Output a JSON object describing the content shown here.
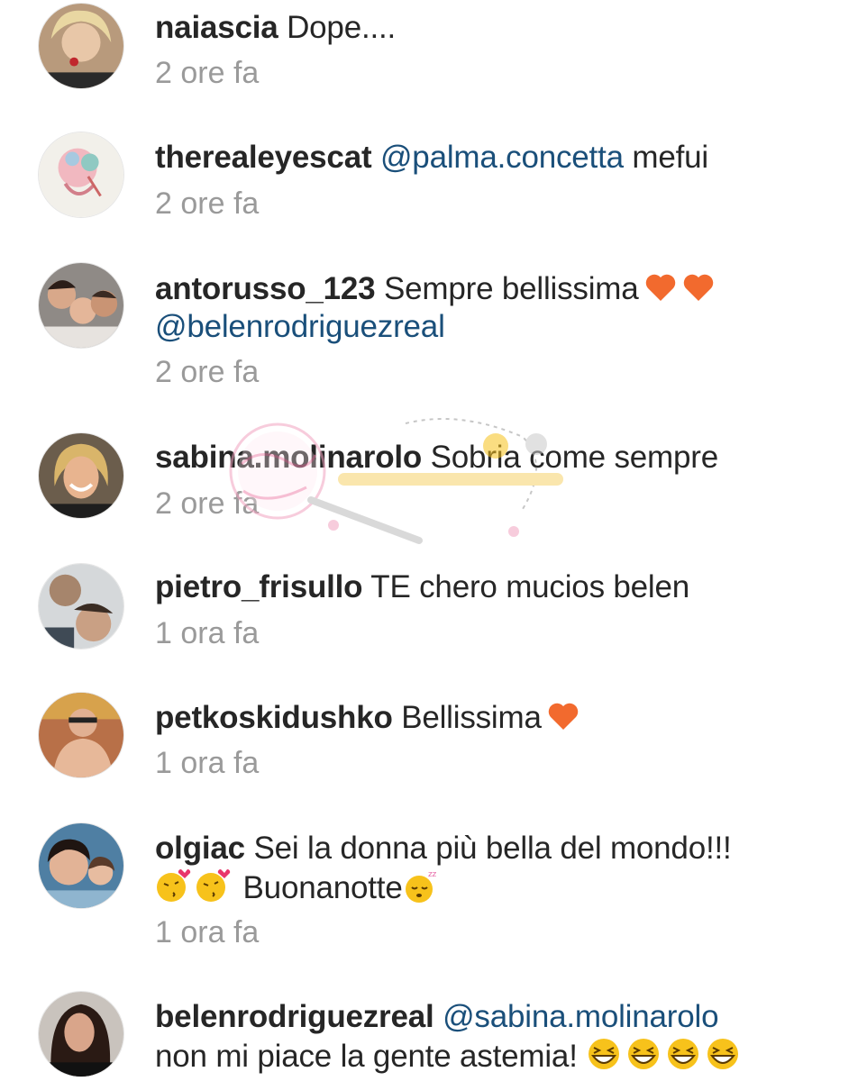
{
  "comments": [
    {
      "username": "naiascia",
      "text": "Dope....",
      "time": "2 ore fa",
      "avatar": "avatar-woman-blonde"
    },
    {
      "username": "therealeyescat",
      "mention": "@palma.concetta",
      "text": "mefui",
      "time": "2 ore fa",
      "avatar": "avatar-illustration"
    },
    {
      "username": "antorusso_123",
      "text": "Sempre bellissima",
      "mention": "@belenrodriguezreal",
      "time": "2 ore fa",
      "avatar": "avatar-group"
    },
    {
      "username": "sabina.molinarolo",
      "text": "Sobria come sempre",
      "time": "2 ore fa",
      "avatar": "avatar-woman-smiling"
    },
    {
      "username": "pietro_frisullo",
      "text": "TE chero mucios belen",
      "time": "1 ora fa",
      "avatar": "avatar-boys"
    },
    {
      "username": "petkoskidushko",
      "text": "Bellissima",
      "time": "1 ora fa",
      "avatar": "avatar-man"
    },
    {
      "username": "olgiac",
      "text": "Sei la donna più bella del mondo!!!",
      "text2": "Buonanotte",
      "time": "1 ora fa",
      "avatar": "avatar-woman-child"
    },
    {
      "username": "belenrodriguezreal",
      "mention": "@sabina.molinarolo",
      "text": "non mi piace la gente astemia!",
      "avatar": "avatar-belen"
    }
  ],
  "colors": {
    "username": "#262626",
    "mention": "#1a4f7a",
    "time": "#9a9a9a",
    "heart": "#f26a2e"
  },
  "icons": [
    "orange-heart-icon",
    "kissing-face-icon",
    "sleeping-face-icon",
    "grinning-squinting-face-icon"
  ]
}
